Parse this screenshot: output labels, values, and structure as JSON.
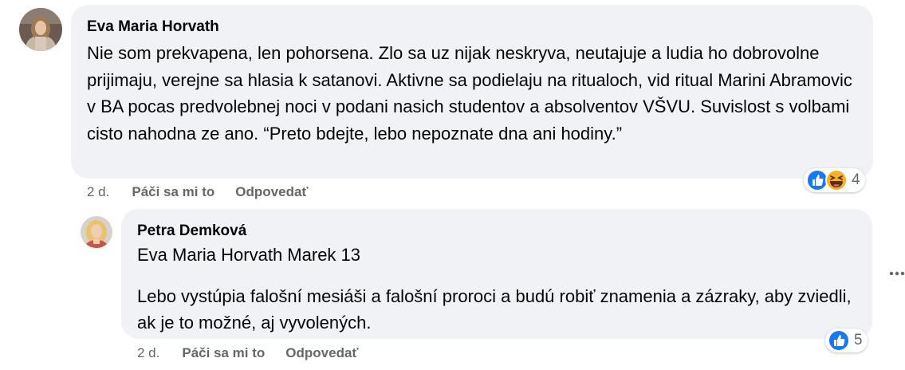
{
  "comment": {
    "author": "Eva Maria Horvath",
    "text": "Nie som prekvapena, len pohorsena. Zlo sa uz nijak neskryva, neutajuje a ludia ho dobrovolne prijimaju, verejne sa hlasia k satanovi. Aktivne sa podielaju na ritualoch, vid ritual Marini Abramovic v BA pocas predvolebnej noci v podani nasich studentov a absolventov VŠVU. Suvislost s volbami cisto nahodna ze ano. “Preto bdejte, lebo nepoznate dna ani hodiny.”",
    "time": "2 d.",
    "like_label": "Páči sa mi to",
    "reply_label": "Odpovedať",
    "reactions": [
      "like-icon",
      "haha-icon"
    ],
    "reaction_count": "4"
  },
  "reply": {
    "author": "Petra Demková",
    "mention": "Eva Maria Horvath",
    "mention_suffix": " Marek 13",
    "text": "Lebo vystúpia falošní mesiáši a falošní proroci a budú robiť znamenia a zázraky, aby zviedli, ak je to možné, aj vyvolených.",
    "time": "2 d.",
    "like_label": "Páči sa mi to",
    "reply_label": "Odpovedať",
    "reactions": [
      "like-icon"
    ],
    "reaction_count": "5"
  },
  "colors": {
    "bubble": "#f0f2f5",
    "meta_text": "#65676b",
    "like_blue": "#1877f2",
    "haha_yellow": "#f7b125"
  }
}
